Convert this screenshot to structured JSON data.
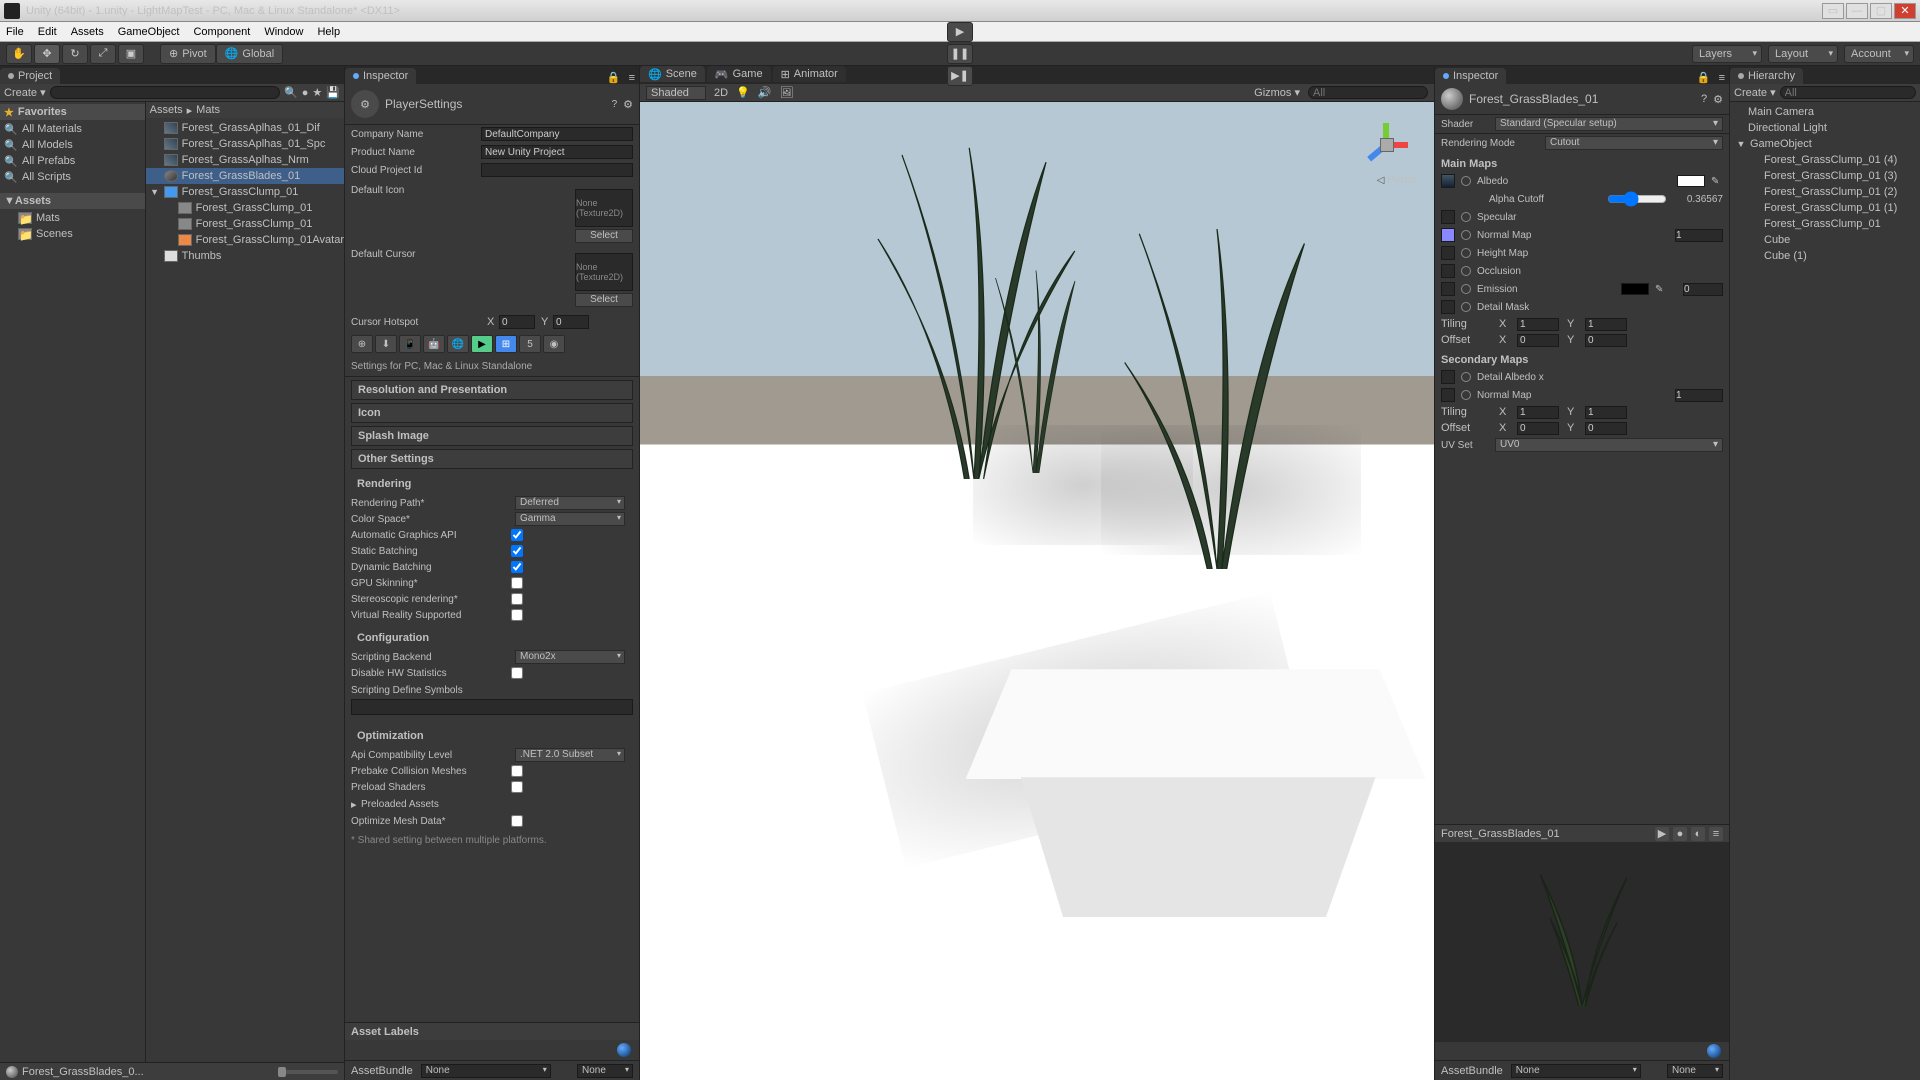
{
  "window": {
    "title": "Unity (64bit) - 1.unity - LightMapTest - PC, Mac & Linux Standalone* <DX11>"
  },
  "menu": [
    "File",
    "Edit",
    "Assets",
    "GameObject",
    "Component",
    "Window",
    "Help"
  ],
  "toolbar": {
    "pivot": "Pivot",
    "global": "Global",
    "layers": "Layers",
    "layout": "Layout",
    "account": "Account"
  },
  "project": {
    "tab": "Project",
    "create": "Create",
    "search_placeholder": "",
    "left": {
      "favorites": "Favorites",
      "fav_items": [
        "All Materials",
        "All Models",
        "All Prefabs",
        "All Scripts"
      ],
      "assets": "Assets",
      "asset_items": [
        "Mats",
        "Scenes"
      ]
    },
    "breadcrumb": [
      "Assets",
      "Mats"
    ],
    "right_items": [
      {
        "name": "Forest_GrassAplhas_01_Dif",
        "sel": false,
        "ico": "tex"
      },
      {
        "name": "Forest_GrassAplhas_01_Spc",
        "sel": false,
        "ico": "tex"
      },
      {
        "name": "Forest_GrassAplhas_Nrm",
        "sel": false,
        "ico": "tex"
      },
      {
        "name": "Forest_GrassBlades_01",
        "sel": true,
        "ico": "mat"
      },
      {
        "name": "Forest_GrassClump_01",
        "sel": false,
        "ico": "prefab",
        "fold": "▼"
      },
      {
        "name": "Forest_GrassClump_01",
        "sel": false,
        "ico": "mesh",
        "indent": 1
      },
      {
        "name": "Forest_GrassClump_01",
        "sel": false,
        "ico": "mesh",
        "indent": 1
      },
      {
        "name": "Forest_GrassClump_01Avatar",
        "sel": false,
        "ico": "avatar",
        "indent": 1
      },
      {
        "name": "Thumbs",
        "sel": false,
        "ico": "file"
      }
    ],
    "footer": "Forest_GrassBlades_0..."
  },
  "inspector1": {
    "tab": "Inspector",
    "title": "PlayerSettings",
    "company": {
      "label": "Company Name",
      "val": "DefaultCompany"
    },
    "product": {
      "label": "Product Name",
      "val": "New Unity Project"
    },
    "cloud": {
      "label": "Cloud Project Id",
      "val": ""
    },
    "default_icon": {
      "label": "Default Icon",
      "slot": "None\n(Texture2D)",
      "btn": "Select"
    },
    "default_cursor": {
      "label": "Default Cursor",
      "slot": "None\n(Texture2D)",
      "btn": "Select"
    },
    "cursor_hotspot": {
      "label": "Cursor Hotspot",
      "x": "0",
      "y": "0",
      "xl": "X",
      "yl": "Y"
    },
    "settings_for": "Settings for PC, Mac & Linux Standalone",
    "sections": {
      "resolution": "Resolution and Presentation",
      "icon": "Icon",
      "splash": "Splash Image",
      "other": "Other Settings"
    },
    "rendering": {
      "hdr": "Rendering",
      "path": {
        "lab": "Rendering Path*",
        "val": "Deferred"
      },
      "color": {
        "lab": "Color Space*",
        "val": "Gamma"
      },
      "autoapi": {
        "lab": "Automatic Graphics API",
        "on": true
      },
      "static_b": {
        "lab": "Static Batching",
        "on": true
      },
      "dyn_b": {
        "lab": "Dynamic Batching",
        "on": true
      },
      "gpu": {
        "lab": "GPU Skinning*",
        "on": false
      },
      "stereo": {
        "lab": "Stereoscopic rendering*",
        "on": false
      },
      "vr": {
        "lab": "Virtual Reality Supported",
        "on": false
      }
    },
    "config": {
      "hdr": "Configuration",
      "backend": {
        "lab": "Scripting Backend",
        "val": "Mono2x"
      },
      "hw": {
        "lab": "Disable HW Statistics",
        "on": false
      },
      "define": {
        "lab": "Scripting Define Symbols"
      }
    },
    "opt": {
      "hdr": "Optimization",
      "api": {
        "lab": "Api Compatibility Level",
        "val": ".NET 2.0 Subset"
      },
      "prebake": {
        "lab": "Prebake Collision Meshes",
        "on": false
      },
      "preload": {
        "lab": "Preload Shaders",
        "on": false
      },
      "preloaded": {
        "lab": "Preloaded Assets"
      },
      "optmesh": {
        "lab": "Optimize Mesh Data*",
        "on": false
      }
    },
    "shared_note": "* Shared setting between multiple platforms.",
    "asset_labels": "Asset Labels",
    "asset_bundle": {
      "lab": "AssetBundle",
      "val1": "None",
      "val2": "None"
    }
  },
  "scene": {
    "tabs": [
      {
        "name": "Scene",
        "icon": "🌐",
        "active": true
      },
      {
        "name": "Game",
        "icon": "🎮",
        "active": false
      },
      {
        "name": "Animator",
        "icon": "⊞",
        "active": false
      }
    ],
    "mode": "Shaded",
    "twod": "2D",
    "gizmos": "Gizmos",
    "search_placeholder": "All",
    "persp": "Persp"
  },
  "inspector2": {
    "tab": "Inspector",
    "name": "Forest_GrassBlades_01",
    "shader": {
      "lab": "Shader",
      "val": "Standard (Specular setup)"
    },
    "render_mode": {
      "lab": "Rendering Mode",
      "val": "Cutout"
    },
    "main_maps": "Main Maps",
    "albedo": "Albedo",
    "alpha": {
      "lab": "Alpha Cutoff",
      "val": "0.36567"
    },
    "specular": "Specular",
    "normal": {
      "lab": "Normal Map",
      "val": "1"
    },
    "height": "Height Map",
    "occlusion": "Occlusion",
    "emission": {
      "lab": "Emission",
      "val": "0"
    },
    "detailmask": "Detail Mask",
    "tiling": {
      "lab": "Tiling",
      "x": "1",
      "y": "1"
    },
    "offset": {
      "lab": "Offset",
      "x": "0",
      "y": "0"
    },
    "secondary": "Secondary Maps",
    "detail_albedo": "Detail Albedo x",
    "normal2": {
      "lab": "Normal Map",
      "val": "1"
    },
    "tiling2": {
      "lab": "Tiling",
      "x": "1",
      "y": "1"
    },
    "offset2": {
      "lab": "Offset",
      "x": "0",
      "y": "0"
    },
    "uvset": {
      "lab": "UV Set",
      "val": "UV0"
    },
    "preview_name": "Forest_GrassBlades_01",
    "asset_bundle": {
      "lab": "AssetBundle",
      "val1": "None",
      "val2": "None"
    }
  },
  "hierarchy": {
    "tab": "Hierarchy",
    "create": "Create",
    "search_placeholder": "All",
    "items": [
      {
        "name": "Main Camera"
      },
      {
        "name": "Directional Light"
      },
      {
        "name": "GameObject",
        "fold": "▼"
      },
      {
        "name": "Forest_GrassClump_01 (4)",
        "indent": 1
      },
      {
        "name": "Forest_GrassClump_01 (3)",
        "indent": 1
      },
      {
        "name": "Forest_GrassClump_01 (2)",
        "indent": 1
      },
      {
        "name": "Forest_GrassClump_01 (1)",
        "indent": 1
      },
      {
        "name": "Forest_GrassClump_01",
        "indent": 1
      },
      {
        "name": "Cube",
        "indent": 1
      },
      {
        "name": "Cube (1)",
        "indent": 1
      }
    ]
  }
}
